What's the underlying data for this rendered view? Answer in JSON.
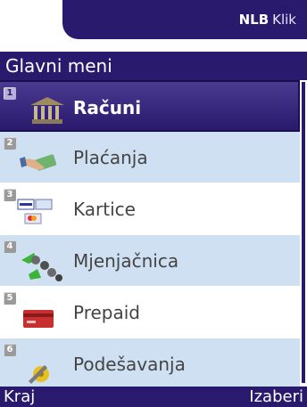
{
  "brand": {
    "bold": "NLB",
    "light": "Klik"
  },
  "title": "Glavni meni",
  "menu": {
    "items": [
      {
        "num": "1",
        "label": "Računi",
        "icon": "bank-icon"
      },
      {
        "num": "2",
        "label": "Plaćanja",
        "icon": "payment-hand-icon"
      },
      {
        "num": "3",
        "label": "Kartice",
        "icon": "cards-icon"
      },
      {
        "num": "4",
        "label": "Mjenjačnica",
        "icon": "exchange-coins-icon"
      },
      {
        "num": "5",
        "label": "Prepaid",
        "icon": "prepaid-card-icon"
      },
      {
        "num": "6",
        "label": "Podešavanja",
        "icon": "settings-tools-icon"
      }
    ]
  },
  "softkeys": {
    "left": "Kraj",
    "right": "Izaberi"
  },
  "colors": {
    "primary": "#2a1a6e",
    "row_alt": "#cfe0f2"
  }
}
